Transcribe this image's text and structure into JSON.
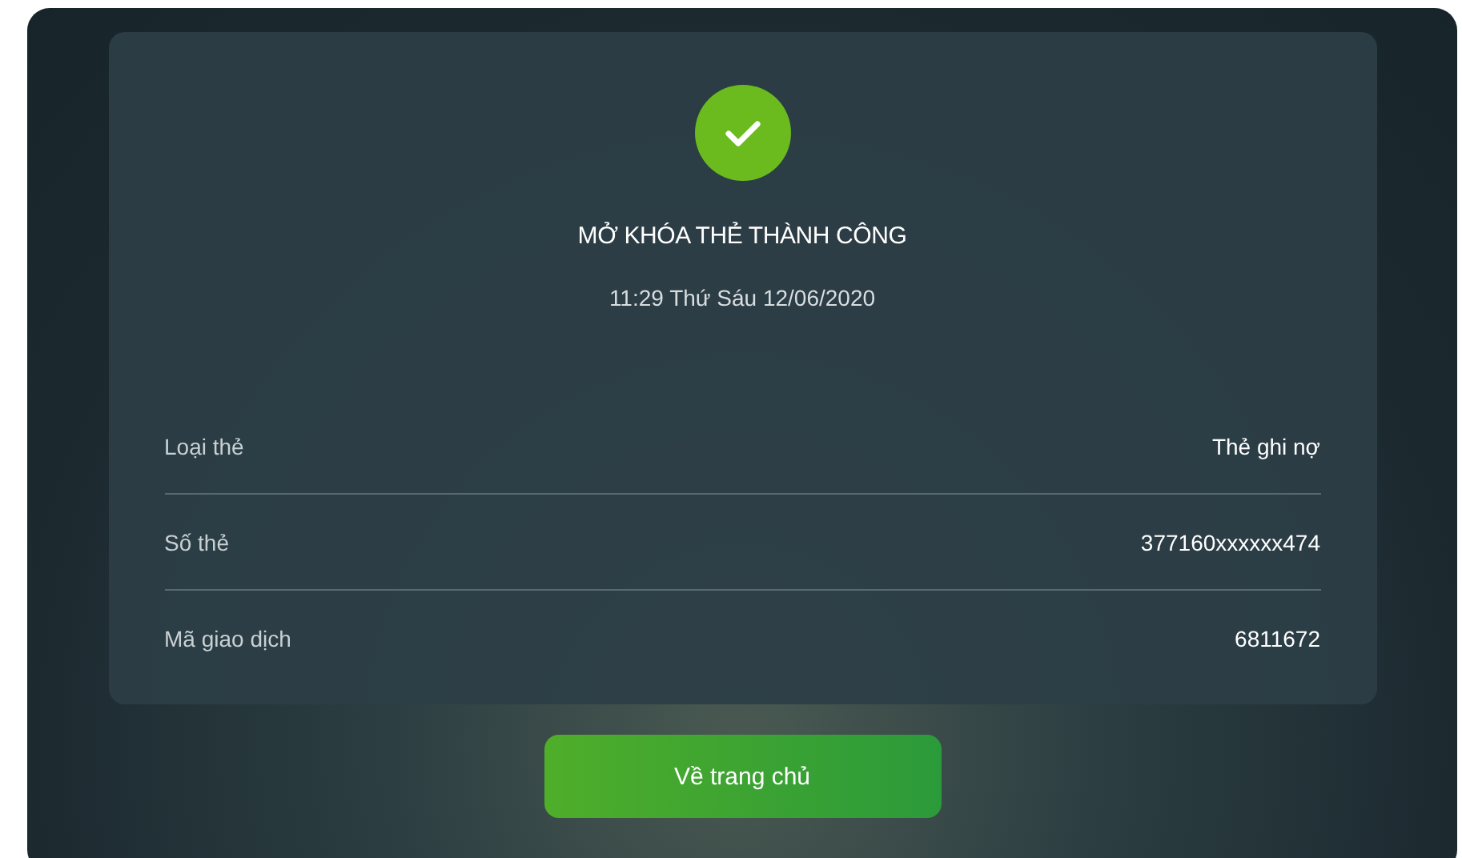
{
  "status": {
    "kind": "success",
    "title": "MỞ KHÓA THẺ THÀNH CÔNG",
    "datetime": "11:29 Thứ Sáu 12/06/2020"
  },
  "details": [
    {
      "label": "Loại thẻ",
      "value": "Thẻ ghi nợ"
    },
    {
      "label": "Số thẻ",
      "value": "377160xxxxxx474"
    },
    {
      "label": "Mã giao dịch",
      "value": "6811672"
    }
  ],
  "button": {
    "label": "Về trang chủ"
  }
}
